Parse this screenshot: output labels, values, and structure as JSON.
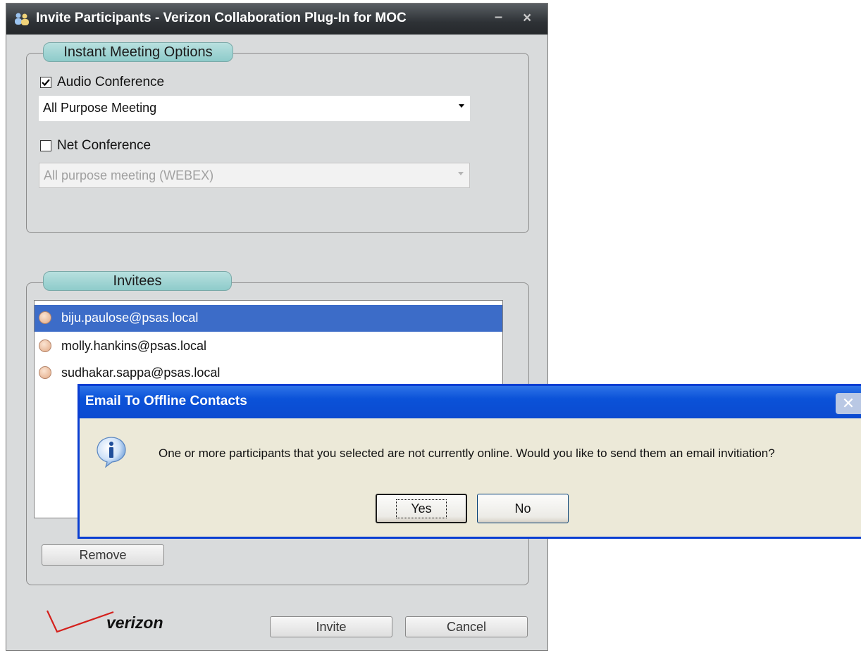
{
  "main_window": {
    "title": "Invite Participants - Verizon Collaboration Plug-In for MOC",
    "minimize_glyph": "–",
    "close_glyph": "×",
    "options_group": {
      "legend": "Instant Meeting Options",
      "audio_conference": {
        "label": "Audio Conference",
        "checked": true
      },
      "audio_combo": {
        "value": "All Purpose Meeting"
      },
      "net_conference": {
        "label": "Net Conference",
        "checked": false
      },
      "net_combo": {
        "value": "All purpose meeting (WEBEX)",
        "disabled": true
      }
    },
    "invitees_group": {
      "legend": "Invitees",
      "items": [
        {
          "email": "biju.paulose@psas.local",
          "selected": true,
          "status": "offline"
        },
        {
          "email": "molly.hankins@psas.local",
          "selected": false,
          "status": "offline"
        },
        {
          "email": "sudhakar.sappa@psas.local",
          "selected": false,
          "status": "offline"
        }
      ],
      "remove_label": "Remove"
    },
    "logo_text": "verizon",
    "invite_label": "Invite",
    "cancel_label": "Cancel"
  },
  "dialog": {
    "title": "Email To Offline Contacts",
    "message": "One or more participants that you selected are not currently online.  Would you like to send them an email invitiation?",
    "yes_label": "Yes",
    "no_label": "No",
    "icon": "info-icon",
    "colors": {
      "titlebar": "#0b52d8",
      "body": "#ece9d8"
    }
  }
}
